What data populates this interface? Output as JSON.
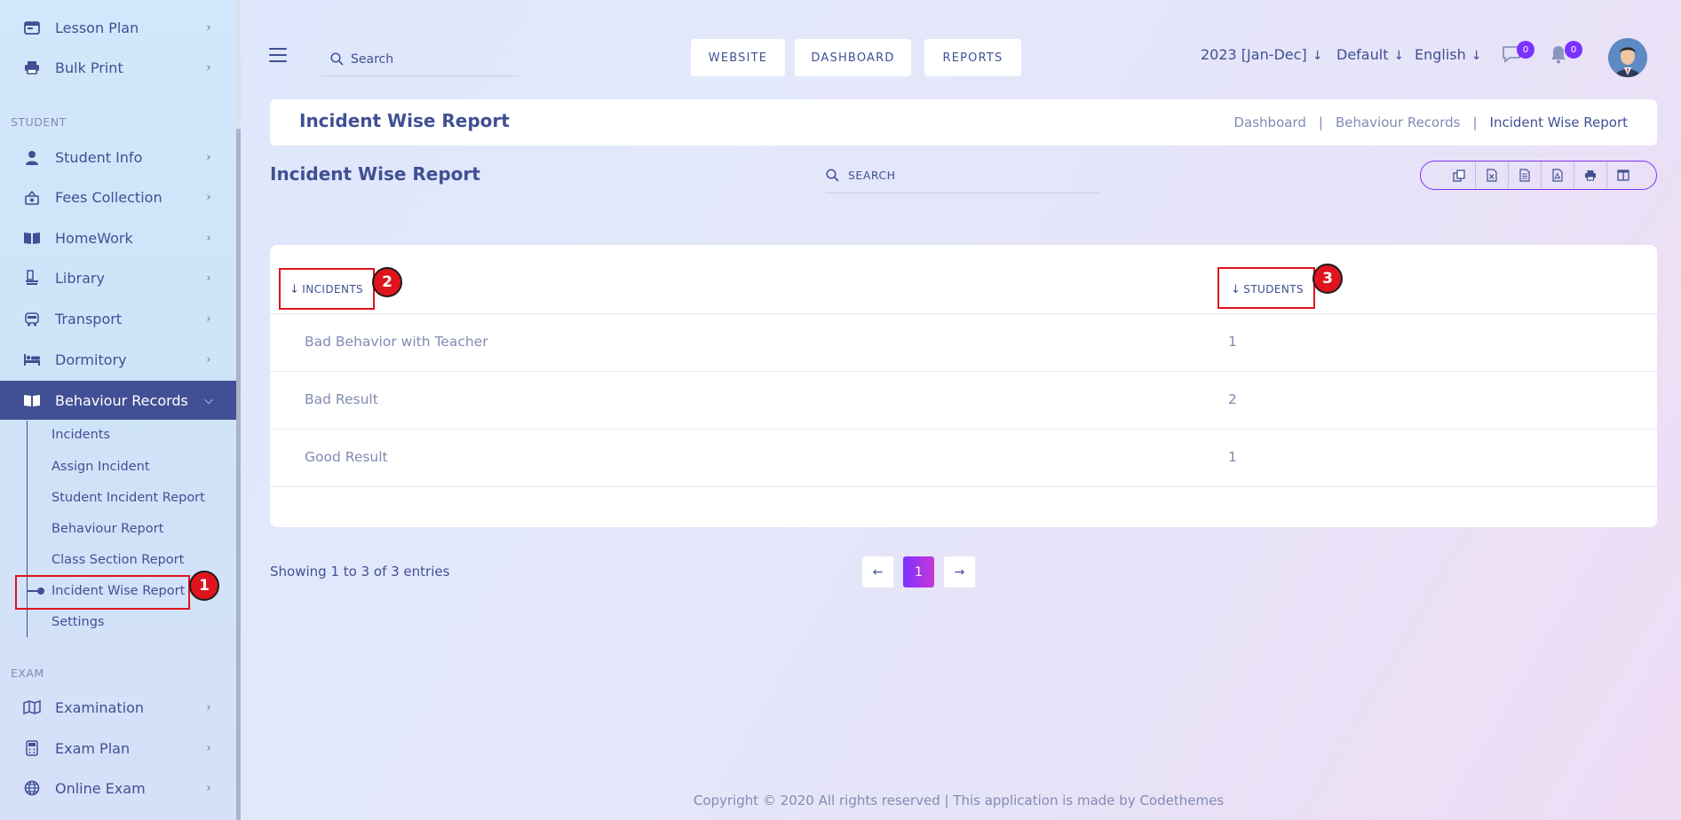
{
  "sidebar": {
    "items": [
      {
        "label": "Lesson Plan"
      },
      {
        "label": "Bulk Print"
      },
      {
        "label": "Student Info"
      },
      {
        "label": "Fees Collection"
      },
      {
        "label": "HomeWork"
      },
      {
        "label": "Library"
      },
      {
        "label": "Transport"
      },
      {
        "label": "Dormitory"
      },
      {
        "label": "Behaviour Records"
      },
      {
        "label": "Examination"
      },
      {
        "label": "Exam Plan"
      },
      {
        "label": "Online Exam"
      }
    ],
    "sections": {
      "student": "STUDENT",
      "exam": "EXAM"
    },
    "sub_items": [
      {
        "label": "Incidents"
      },
      {
        "label": "Assign Incident"
      },
      {
        "label": "Student Incident Report"
      },
      {
        "label": "Behaviour Report"
      },
      {
        "label": "Class Section Report"
      },
      {
        "label": "Incident Wise Report"
      },
      {
        "label": "Settings"
      }
    ]
  },
  "header": {
    "search_placeholder": "Search",
    "nav": {
      "website": "WEBSITE",
      "dashboard": "DASHBOARD",
      "reports": "REPORTS"
    },
    "session": "2023 [Jan-Dec]",
    "theme": "Default",
    "language": "English",
    "messages_count": "0",
    "notifications_count": "0"
  },
  "page": {
    "title": "Incident Wise Report",
    "breadcrumb": {
      "home": "Dashboard",
      "parent": "Behaviour Records",
      "current": "Incident Wise Report"
    },
    "section_title": "Incident Wise Report",
    "table_search_placeholder": "SEARCH"
  },
  "table": {
    "columns": {
      "incidents": "INCIDENTS",
      "students": "STUDENTS"
    },
    "rows": [
      {
        "incident": "Bad Behavior with Teacher",
        "students": "1"
      },
      {
        "incident": "Bad Result",
        "students": "2"
      },
      {
        "incident": "Good Result",
        "students": "1"
      }
    ]
  },
  "pagination": {
    "info": "Showing 1 to 3 of 3 entries",
    "current": "1",
    "prev": "←",
    "next": "→"
  },
  "annotations": {
    "one": "1",
    "two": "2",
    "three": "3"
  },
  "footer": {
    "copyright": "Copyright © 2020 All rights reserved | This application is made by Codethemes"
  },
  "colors": {
    "primary": "#415094",
    "accent": "#7c32ff",
    "muted": "#828bb2",
    "annotation": "#e0141e"
  }
}
